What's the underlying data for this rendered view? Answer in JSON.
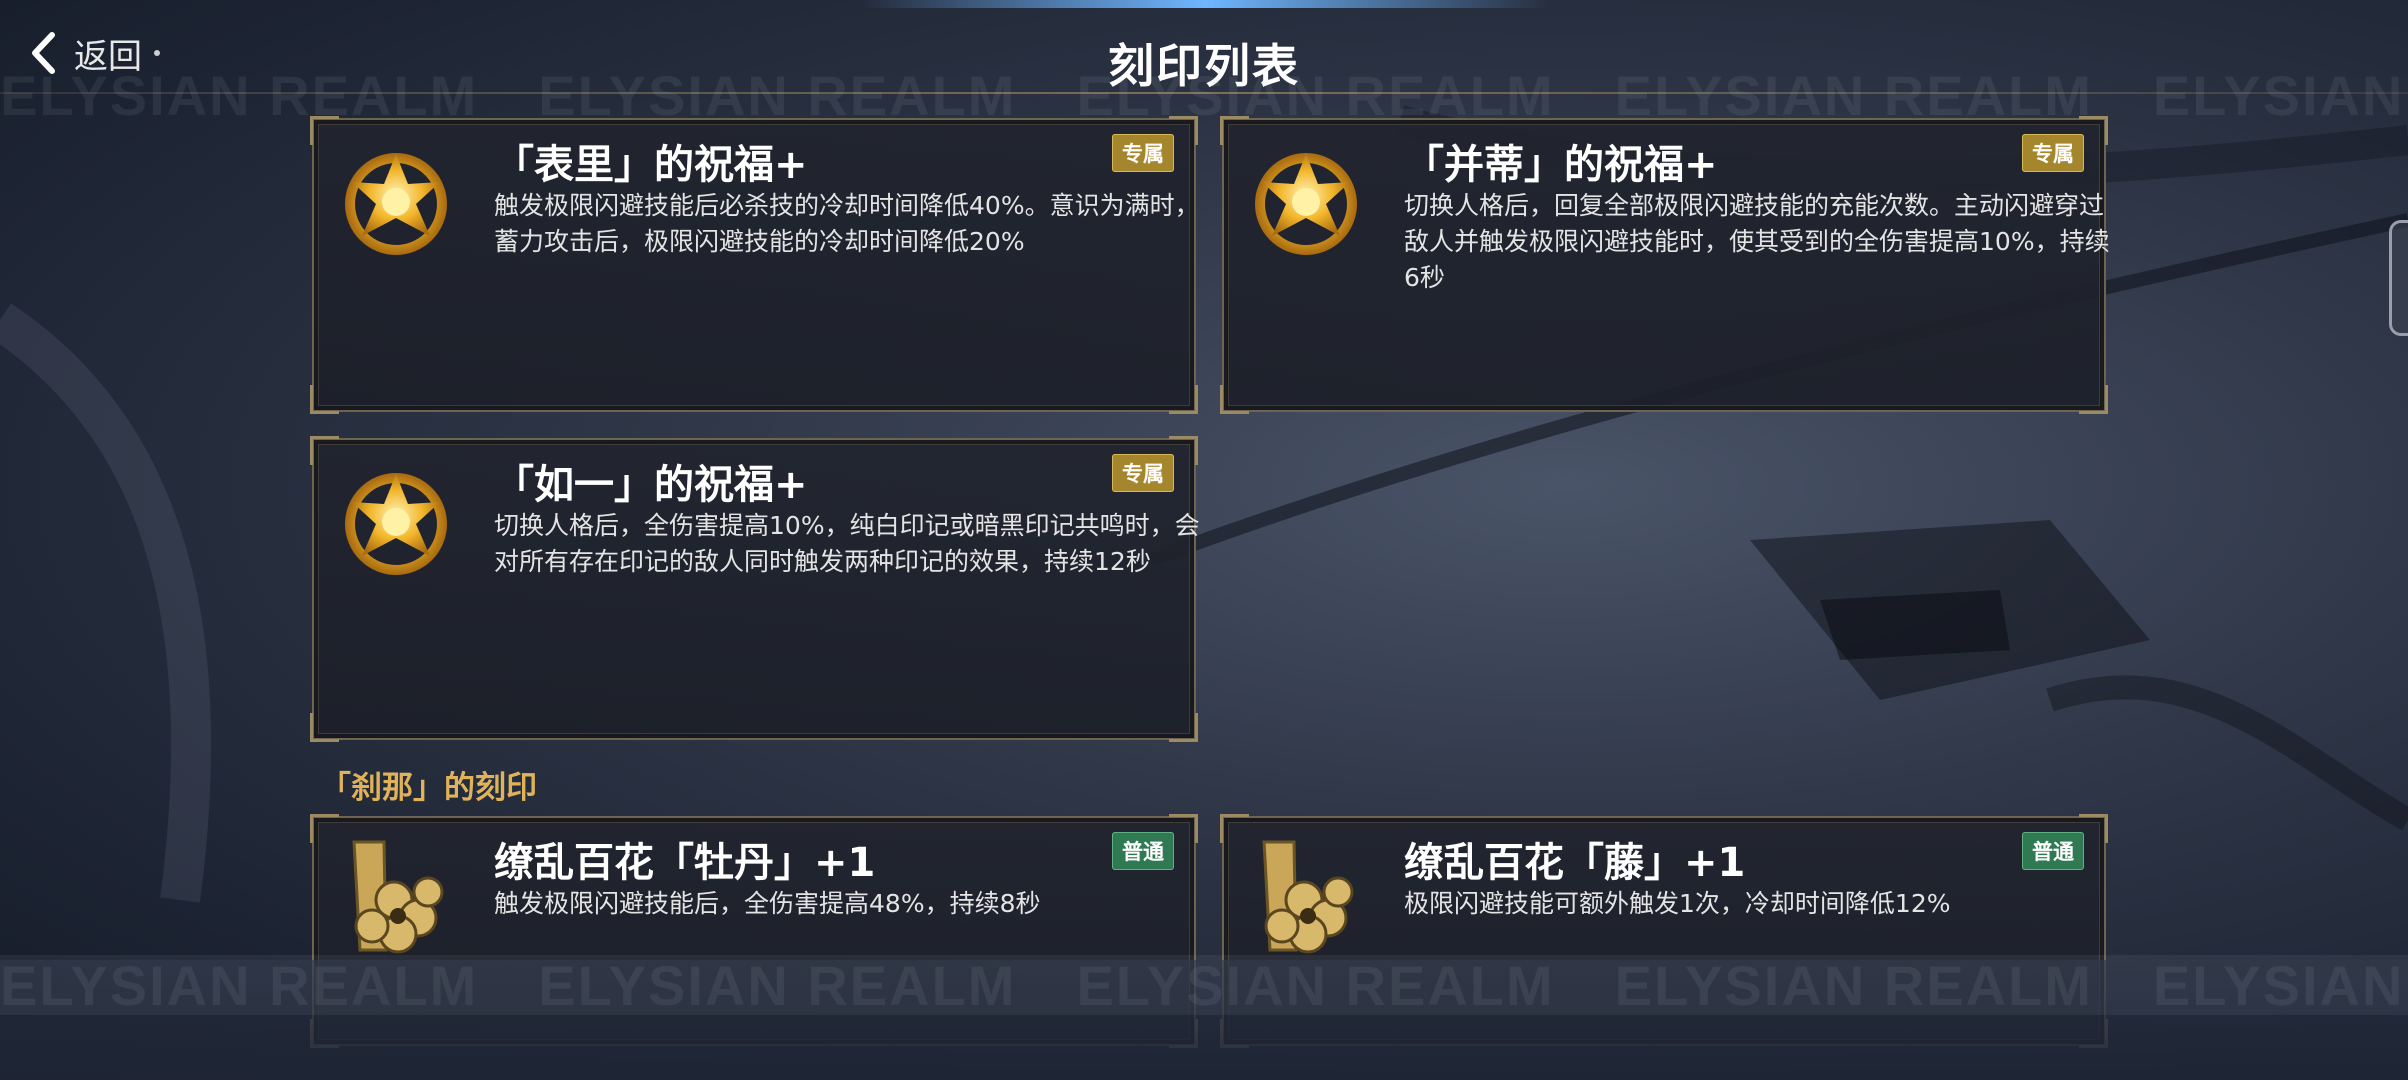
{
  "header": {
    "back_label": "返回",
    "title": "刻印列表",
    "watermark": "ELYSIAN REALM"
  },
  "blessings": [
    {
      "title": "「表里」的祝福+",
      "tag": "专属",
      "description": "触发极限闪避技能后必杀技的冷却时间降低40%。意识为满时，蓄力攻击后，极限闪避技能的冷却时间降低20%",
      "icon": "lotus-emblem-icon"
    },
    {
      "title": "「并蒂」的祝福+",
      "tag": "专属",
      "description": "切换人格后，回复全部极限闪避技能的充能次数。主动闪避穿过敌人并触发极限闪避技能时，使其受到的全伤害提高10%，持续6秒",
      "icon": "lotus-emblem-icon"
    },
    {
      "title": "「如一」的祝福+",
      "tag": "专属",
      "description": "切换人格后，全伤害提高10%，纯白印记或暗黑印记共鸣时，会对所有存在印记的敌人同时触发两种印记的效果，持续12秒",
      "icon": "lotus-emblem-icon"
    }
  ],
  "section": {
    "label": "「刹那」的刻印"
  },
  "signets": [
    {
      "title": "缭乱百花「牡丹」+1",
      "tag": "普通",
      "description": "触发极限闪避技能后，全伤害提高48%，持续8秒",
      "icon": "blade-blossom-icon"
    },
    {
      "title": "缭乱百花「藤」+1",
      "tag": "普通",
      "description": "极限闪避技能可额外触发1次，冷却时间降低12%",
      "icon": "blade-blossom-icon"
    }
  ],
  "colors": {
    "tag_exclusive": "#a5862c",
    "tag_normal": "#2f7a52",
    "section_label": "#e0b35a",
    "card_border": "#6e6450"
  }
}
